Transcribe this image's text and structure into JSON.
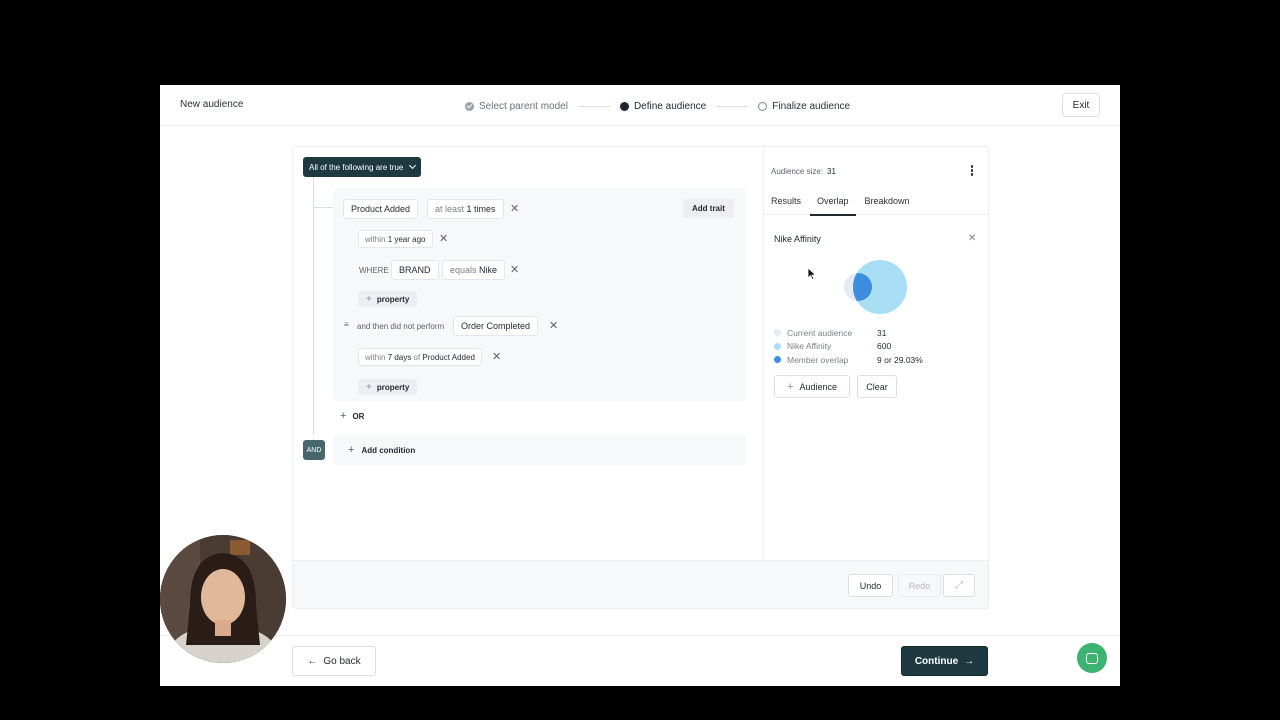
{
  "header": {
    "title": "New audience",
    "steps": [
      {
        "label": "Select parent model",
        "state": "done"
      },
      {
        "label": "Define audience",
        "state": "active"
      },
      {
        "label": "Finalize audience",
        "state": "todo"
      }
    ],
    "exit_label": "Exit"
  },
  "builder": {
    "mode_label": "All of the following are true",
    "event": {
      "name": "Product Added",
      "frequency_prefix": "at least",
      "frequency_value": "1 times",
      "add_trait_label": "Add trait",
      "within_prefix": "within",
      "within_value": "1 year ago",
      "where_label": "WHERE",
      "where_property": "BRAND",
      "where_op": "equals",
      "where_value": "Nike",
      "property_label": "property"
    },
    "then": {
      "label": "and then did not perform",
      "event_name": "Order Completed",
      "within_prefix": "within",
      "within_value": "7 days",
      "of_label": "of",
      "of_event": "Product Added",
      "property_label": "property"
    },
    "or_label": "OR",
    "and_label": "AND",
    "add_condition_label": "Add condition"
  },
  "panel": {
    "audience_size_label": "Audience size:",
    "audience_size_value": "31",
    "tabs": [
      "Results",
      "Overlap",
      "Breakdown"
    ],
    "active_tab": "Overlap",
    "overlap_title": "Nike Affinity",
    "legend": [
      {
        "label": "Current audience",
        "value": "31",
        "color": "#e4ebf5"
      },
      {
        "label": "Nike Affinity",
        "value": "600",
        "color": "#a8dff5"
      },
      {
        "label": "Member overlap",
        "value": "9 or 29.03%",
        "color": "#3d8ee0"
      }
    ],
    "audience_button_label": "Audience",
    "clear_button_label": "Clear"
  },
  "card_footer": {
    "undo_label": "Undo",
    "redo_label": "Redo"
  },
  "footer": {
    "go_back_label": "Go back",
    "continue_label": "Continue"
  },
  "colors": {
    "primary": "#1e3a40",
    "and_badge": "#47676c",
    "chat": "#3cb371"
  }
}
